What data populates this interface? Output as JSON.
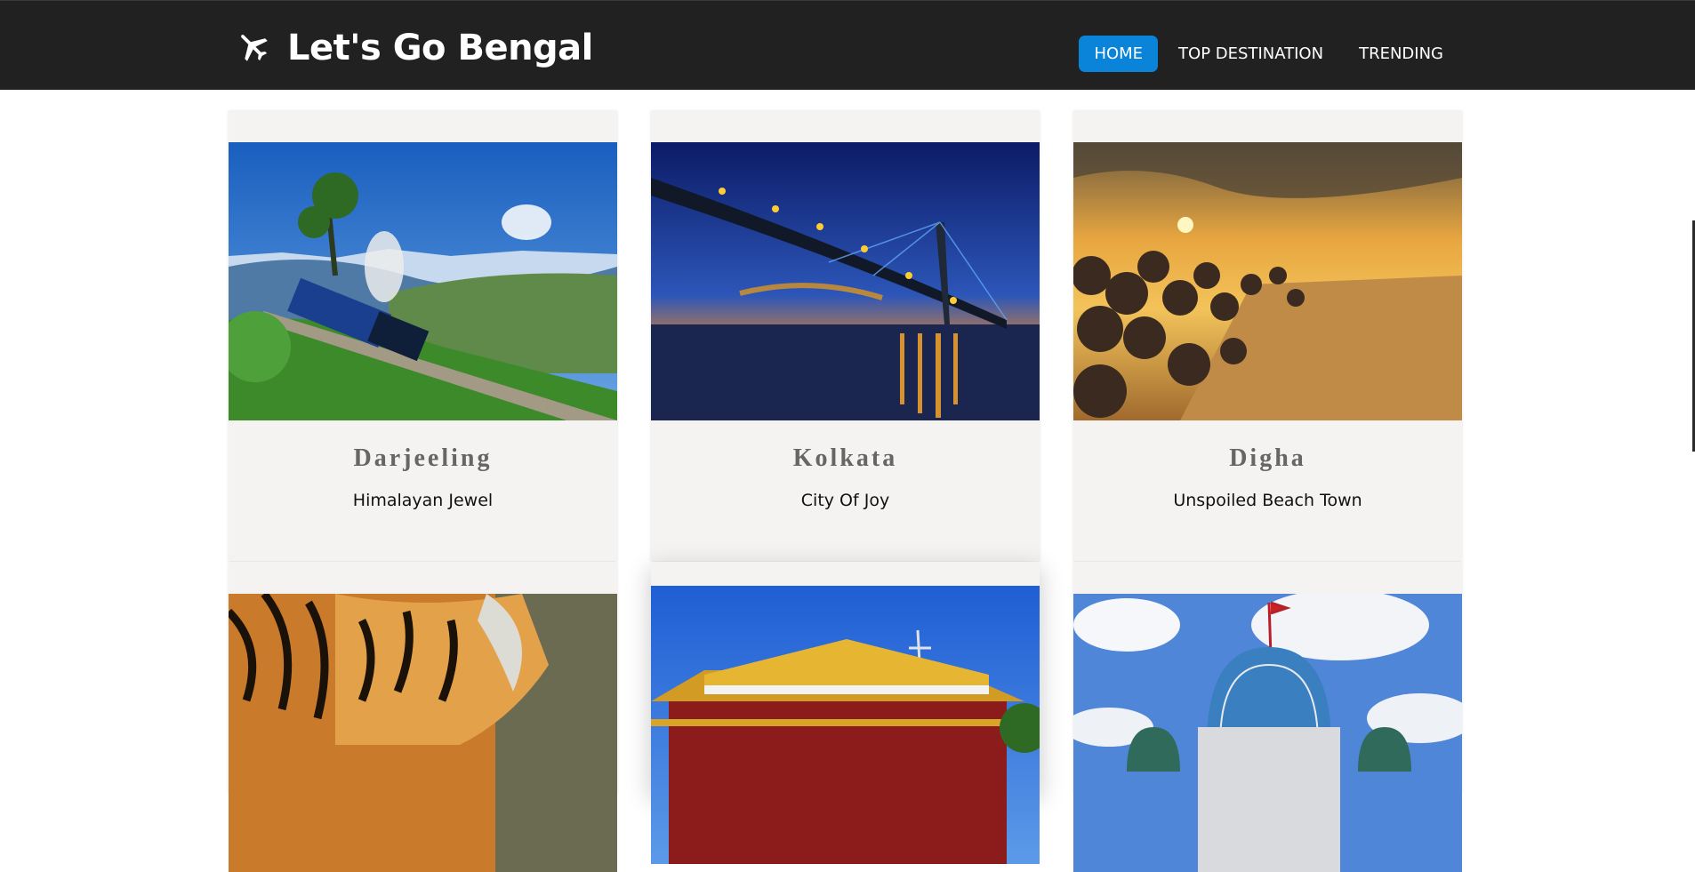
{
  "brand": {
    "title": "Let's Go Bengal",
    "icon": "airplane-icon"
  },
  "nav": {
    "items": [
      {
        "label": "HOME",
        "active": true
      },
      {
        "label": "TOP DESTINATION",
        "active": false
      },
      {
        "label": "TRENDING",
        "active": false
      }
    ]
  },
  "cards": [
    {
      "title": "Darjeeling",
      "subtitle": "Himalayan Jewel",
      "image": "toy-train-mountain-photo"
    },
    {
      "title": "Kolkata",
      "subtitle": "City Of Joy",
      "image": "bridge-at-night-photo"
    },
    {
      "title": "Digha",
      "subtitle": "Unspoiled Beach Town",
      "image": "beach-sunset-photo"
    },
    {
      "title": "",
      "subtitle": "",
      "image": "tiger-photo"
    },
    {
      "title": "",
      "subtitle": "",
      "image": "monastery-photo"
    },
    {
      "title": "",
      "subtitle": "",
      "image": "temple-dome-photo"
    }
  ],
  "colors": {
    "navbar": "#212121",
    "accent": "#0a84d9",
    "card": "#f5f3f1"
  }
}
